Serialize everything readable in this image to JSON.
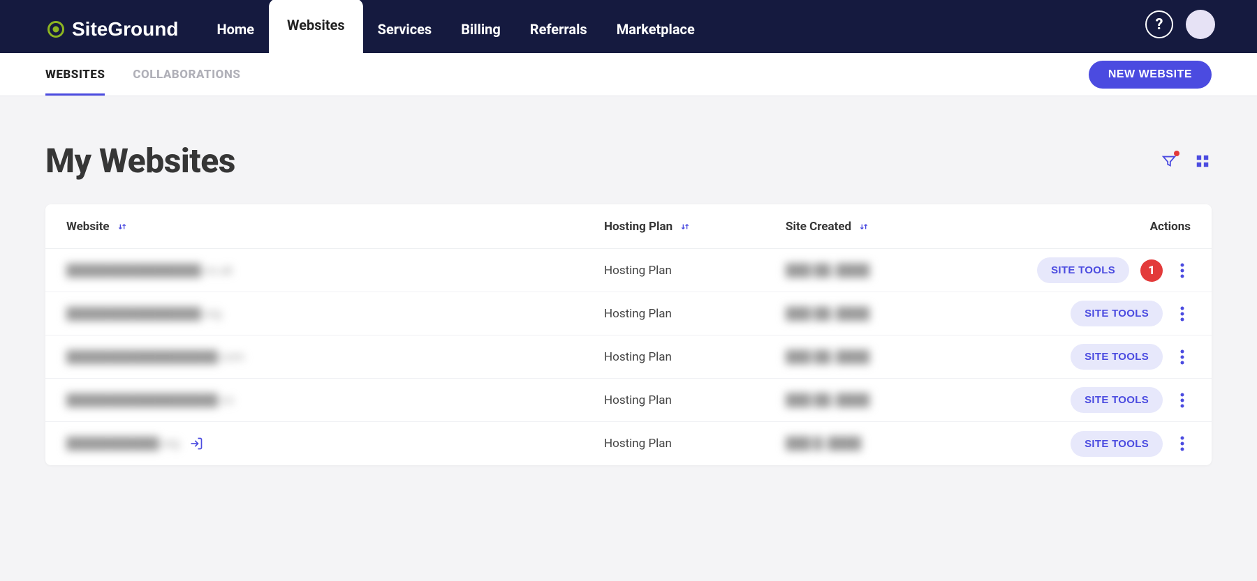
{
  "brand": "SiteGround",
  "nav": {
    "items": [
      {
        "label": "Home"
      },
      {
        "label": "Websites"
      },
      {
        "label": "Services"
      },
      {
        "label": "Billing"
      },
      {
        "label": "Referrals"
      },
      {
        "label": "Marketplace"
      }
    ],
    "help": "?"
  },
  "subnav": {
    "tabs": [
      {
        "label": "WEBSITES"
      },
      {
        "label": "COLLABORATIONS"
      }
    ],
    "primary": "NEW WEBSITE"
  },
  "page": {
    "title": "My Websites"
  },
  "table": {
    "headers": {
      "website": "Website",
      "plan": "Hosting Plan",
      "created": "Site Created",
      "actions": "Actions"
    },
    "site_tools_label": "SITE TOOLS",
    "annotation_number": "1",
    "rows": [
      {
        "website": "████████████████.co.uk",
        "plan": "Hosting Plan",
        "created": "███ ██, ████",
        "has_login": false,
        "has_annotation": true
      },
      {
        "website": "████████████████.org",
        "plan": "Hosting Plan",
        "created": "███ ██, ████",
        "has_login": false,
        "has_annotation": false
      },
      {
        "website": "██████████████████.com",
        "plan": "Hosting Plan",
        "created": "███ ██, ████",
        "has_login": false,
        "has_annotation": false
      },
      {
        "website": "██████████████████.co",
        "plan": "Hosting Plan",
        "created": "███ ██, ████",
        "has_login": false,
        "has_annotation": false
      },
      {
        "website": "███████████.org",
        "plan": "Hosting Plan",
        "created": "███ █, ████",
        "has_login": true,
        "has_annotation": false
      }
    ]
  }
}
